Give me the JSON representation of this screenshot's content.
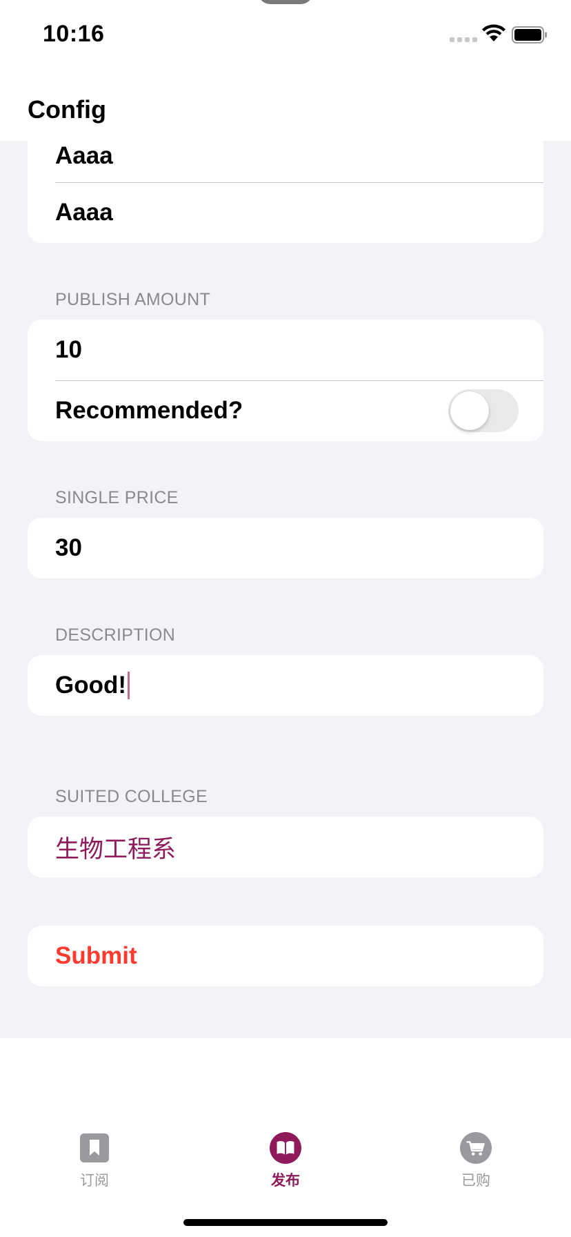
{
  "status": {
    "time": "10:16"
  },
  "header": {
    "title": "Config"
  },
  "top_card": {
    "rows": [
      "Aaaa",
      "Aaaa"
    ]
  },
  "publish": {
    "label": "PUBLISH AMOUNT",
    "amount": "10",
    "recommended_label": "Recommended?",
    "recommended_on": false
  },
  "price": {
    "label": "SINGLE PRICE",
    "value": "30"
  },
  "description": {
    "label": "DESCRIPTION",
    "value": "Good!"
  },
  "college": {
    "label": "SUITED COLLEGE",
    "value": "生物工程系"
  },
  "submit": {
    "label": "Submit"
  },
  "tabs": [
    {
      "label": "订阅",
      "icon": "bookmark-icon",
      "active": false
    },
    {
      "label": "发布",
      "icon": "book-icon",
      "active": true
    },
    {
      "label": "已购",
      "icon": "cart-icon",
      "active": false
    }
  ],
  "colors": {
    "accent": "#8e1a5a",
    "destructive": "#ff3b30",
    "background": "#f2f2f7"
  }
}
